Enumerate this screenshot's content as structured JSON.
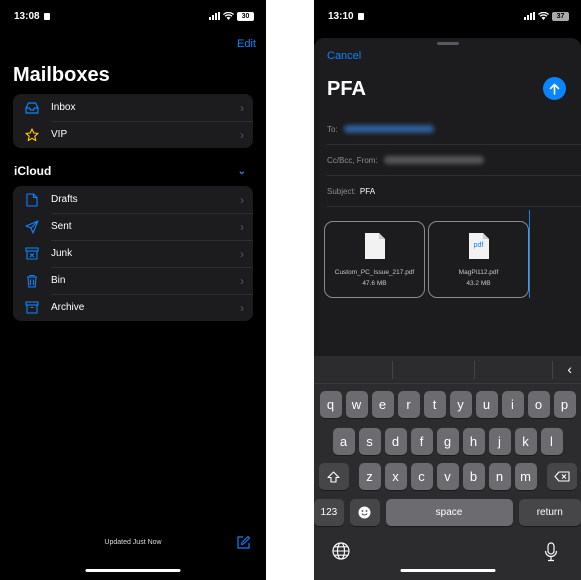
{
  "colors": {
    "accent": "#0a84ff",
    "background": "#000000",
    "group": "#1c1c1e",
    "vip_star": "#ffcc00"
  },
  "left": {
    "status": {
      "time": "13:08",
      "battery": "30"
    },
    "edit_label": "Edit",
    "title": "Mailboxes",
    "top_items": [
      {
        "label": "Inbox",
        "icon": "inbox-icon"
      },
      {
        "label": "VIP",
        "icon": "star-icon"
      }
    ],
    "section_title": "iCloud",
    "section_chevron": "chevron-down-icon",
    "icloud_items": [
      {
        "label": "Drafts",
        "icon": "document-icon"
      },
      {
        "label": "Sent",
        "icon": "paperplane-icon"
      },
      {
        "label": "Junk",
        "icon": "junk-box-icon"
      },
      {
        "label": "Bin",
        "icon": "trash-icon"
      },
      {
        "label": "Archive",
        "icon": "archive-box-icon"
      }
    ],
    "footer_status": "Updated Just Now",
    "compose_icon": "compose-icon"
  },
  "right": {
    "status": {
      "time": "13:10",
      "battery": "37"
    },
    "cancel_label": "Cancel",
    "subject_heading": "PFA",
    "send_icon": "arrow-up-icon",
    "to_label": "To:",
    "cc_label": "Cc/Bcc, From:",
    "subject_label": "Subject:",
    "subject_value": "PFA",
    "attachments": [
      {
        "name": "Custom_PC_Issue_217.pdf",
        "size": "47.6 MB",
        "icon": "blank-document-icon"
      },
      {
        "name": "MagPi112.pdf",
        "size": "43.2 MB",
        "icon": "pdf-document-icon",
        "badge": "pdf"
      }
    ],
    "keyboard": {
      "row1": [
        "q",
        "w",
        "e",
        "r",
        "t",
        "y",
        "u",
        "i",
        "o",
        "p"
      ],
      "row2": [
        "a",
        "s",
        "d",
        "f",
        "g",
        "h",
        "j",
        "k",
        "l"
      ],
      "row3": [
        "z",
        "x",
        "c",
        "v",
        "b",
        "n",
        "m"
      ],
      "numbers_label": "123",
      "space_label": "space",
      "return_label": "return",
      "shift_icon": "shift-icon",
      "delete_icon": "delete-icon",
      "emoji_icon": "emoji-icon",
      "globe_icon": "globe-icon",
      "mic_icon": "microphone-icon",
      "collapse_icon": "chevron-left-icon"
    }
  }
}
